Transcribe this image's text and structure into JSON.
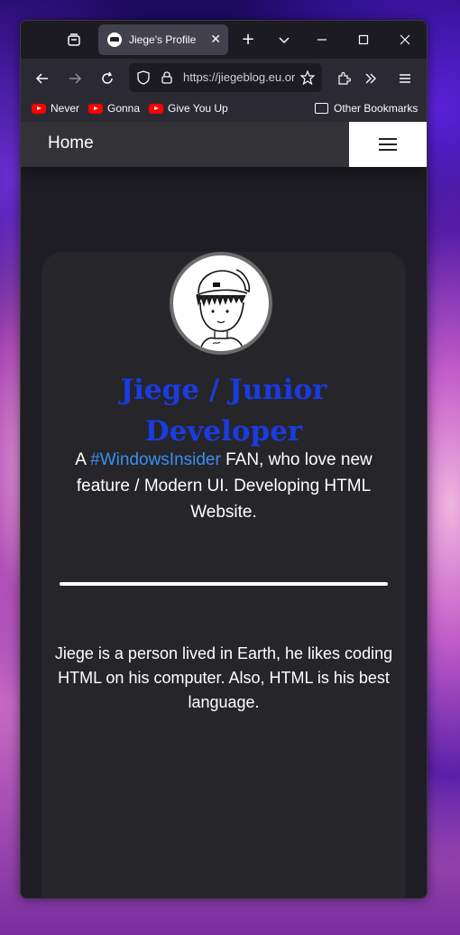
{
  "browser": {
    "tab": {
      "title": "Jiege's Profile"
    },
    "url": "https://jiegeblog.eu.org",
    "bookmarks": [
      {
        "label": "Never",
        "icon": "youtube-icon"
      },
      {
        "label": "Gonna",
        "icon": "youtube-icon"
      },
      {
        "label": "Give You Up",
        "icon": "youtube-icon"
      }
    ],
    "other_bookmarks": "Other Bookmarks"
  },
  "site": {
    "nav": {
      "home": "Home"
    },
    "profile": {
      "name": "Jiege / Junior Developer",
      "bio_prefix": "A",
      "bio_tag": "#WindowsInsider",
      "bio_suffix": "FAN, who love new feature / Modern UI. Developing HTML Website.",
      "about": "Jiege is a person lived in Earth, he likes coding HTML on his computer. Also, HTML is his best language."
    }
  },
  "colors": {
    "accent": "#1a3be0",
    "link": "#3a8ff0",
    "card_bg": "#262529",
    "page_bg": "#1f1d24"
  }
}
